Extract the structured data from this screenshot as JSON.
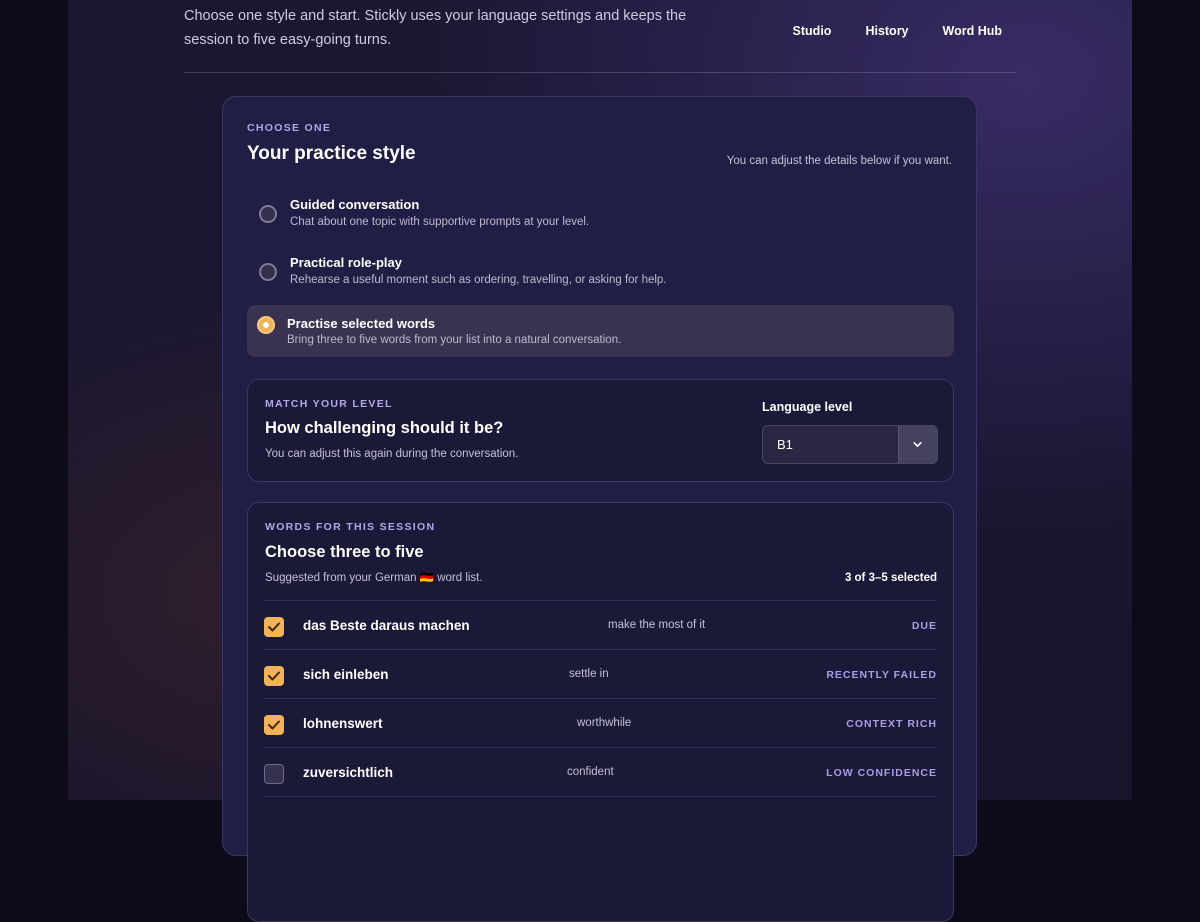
{
  "header": {
    "intro": "Choose one style and start. Stickly uses your language settings and keeps the session to five easy-going turns.",
    "nav": [
      {
        "label": "Studio"
      },
      {
        "label": "History"
      },
      {
        "label": "Word Hub"
      }
    ]
  },
  "practice": {
    "eyebrow": "CHOOSE ONE",
    "title": "Your practice style",
    "hint": "You can adjust the details below if you want.",
    "options": [
      {
        "title": "Guided conversation",
        "description": "Chat about one topic with supportive prompts at your level.",
        "selected": false
      },
      {
        "title": "Practical role-play",
        "description": "Rehearse a useful moment such as ordering, travelling, or asking for help.",
        "selected": false
      },
      {
        "title": "Practise selected words",
        "description": "Bring three to five words from your list into a natural conversation.",
        "selected": true
      }
    ]
  },
  "level": {
    "eyebrow": "MATCH YOUR LEVEL",
    "title": "How challenging should it be?",
    "note": "You can adjust this again during the conversation.",
    "select_label": "Language level",
    "selected_value": "B1"
  },
  "words": {
    "eyebrow": "WORDS FOR THIS SESSION",
    "title": "Choose three to five",
    "note": "Suggested from your German 🇩🇪 word list.",
    "count": "3 of 3–5 selected",
    "items": [
      {
        "term": "das Beste daraus machen",
        "meaning": "make the most of it",
        "tag": "DUE",
        "checked": true
      },
      {
        "term": "sich einleben",
        "meaning": "settle in",
        "tag": "RECENTLY FAILED",
        "checked": true
      },
      {
        "term": "lohnenswert",
        "meaning": "worthwhile",
        "tag": "CONTEXT RICH",
        "checked": true
      },
      {
        "term": "zuversichtlich",
        "meaning": "confident",
        "tag": "LOW CONFIDENCE",
        "checked": false
      }
    ]
  },
  "colors": {
    "accent": "#f2b258",
    "eyebrow": "#b2a8e8",
    "card": "#211e45"
  },
  "icons": {
    "check": "check-icon",
    "chevron": "chevron-down-icon"
  }
}
